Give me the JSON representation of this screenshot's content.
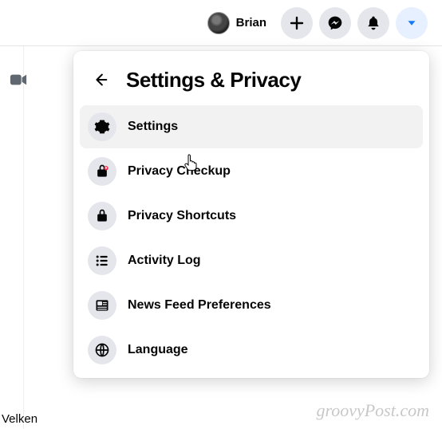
{
  "topbar": {
    "profile_name": "Brian",
    "buttons": {
      "create": "plus-icon",
      "messenger": "messenger-icon",
      "notifications": "bell-icon",
      "account": "caret-down-icon"
    }
  },
  "dropdown": {
    "title": "Settings & Privacy",
    "items": [
      {
        "icon": "gear-icon",
        "label": "Settings",
        "hovered": true
      },
      {
        "icon": "lock-heart-icon",
        "label": "Privacy Checkup",
        "hovered": false
      },
      {
        "icon": "lock-icon",
        "label": "Privacy Shortcuts",
        "hovered": false
      },
      {
        "icon": "list-icon",
        "label": "Activity Log",
        "hovered": false
      },
      {
        "icon": "newspaper-icon",
        "label": "News Feed Preferences",
        "hovered": false
      },
      {
        "icon": "globe-icon",
        "label": "Language",
        "hovered": false
      }
    ]
  },
  "sidebar_partial_text": "Velken",
  "watermark": "groovyPost.com"
}
